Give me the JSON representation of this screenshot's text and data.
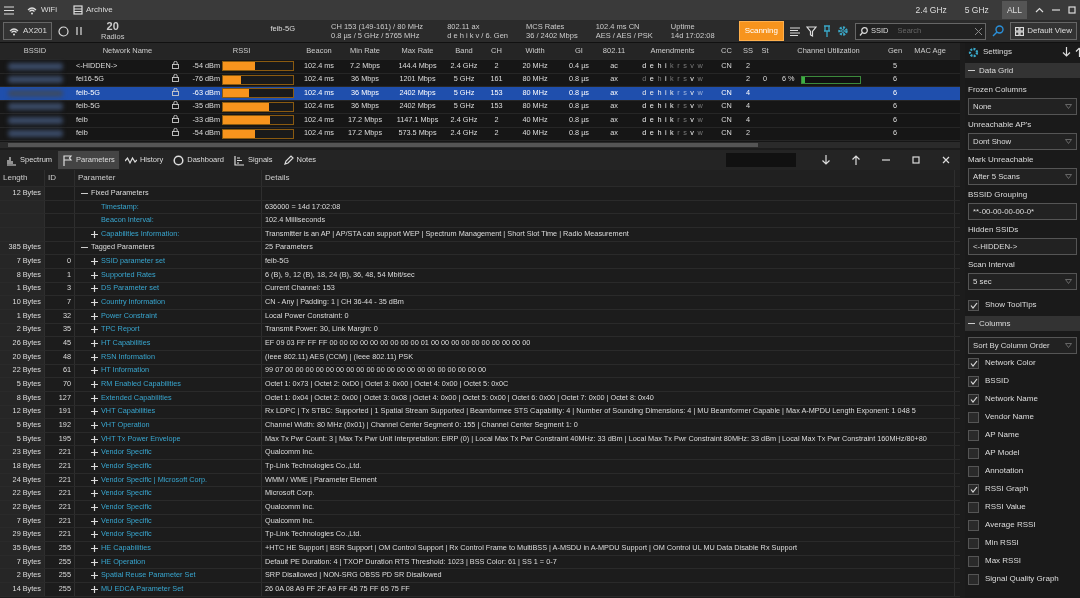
{
  "title_bar": {
    "menu_items": [
      "WiFi",
      "Archive"
    ],
    "band_filters": [
      {
        "label": "2.4 GHz",
        "selected": false
      },
      {
        "label": "5 GHz",
        "selected": false
      },
      {
        "label": "ALL",
        "selected": true
      }
    ]
  },
  "toolbar": {
    "adapter": "AX201",
    "radios_count": "20",
    "radios_label": "Radios",
    "ssid": "feib-5G",
    "info": [
      {
        "line1": "CH  153 (149-161)  /  80 MHz",
        "line2": "0.8 µs / 5 GHz / 5765 MHz"
      },
      {
        "line1": "802.11 ax",
        "line2": "d  e  h  i  k  v  /  6. Gen"
      },
      {
        "line1": "MCS Rates",
        "line2": "36 / 2402 Mbps"
      },
      {
        "line1": "102.4 ms   CN",
        "line2": "AES / AES / PSK"
      },
      {
        "line1": "Uptime",
        "line2": "14d 17:02:08"
      }
    ],
    "scan_button": {
      "label": "Scanning",
      "on": true
    },
    "search": {
      "field": "SSID",
      "placeholder": "Search"
    },
    "view_button": "Default View"
  },
  "networks": {
    "columns": [
      "BSSID",
      "Network Name",
      "RSSI",
      "Beacon",
      "Min Rate",
      "Max Rate",
      "Band",
      "CH",
      "Width",
      "GI",
      "802.11",
      "Amendments",
      "CC",
      "SS",
      "St",
      "Channel Utilization",
      "Gen",
      "MAC Age"
    ],
    "rows": [
      {
        "name": "<-HIDDEN->",
        "rssi": "-54 dBm",
        "level": 0.45,
        "beacon": "102.4 ms",
        "min_rate": "7.2 Mbps",
        "max_rate": "144.4 Mbps",
        "band": "2.4 GHz",
        "ch": "2",
        "width": "20 MHz",
        "gi": "0.4 µs",
        "std": "ac",
        "cc": "CN",
        "ss": "2",
        "gen": "5",
        "selected": false,
        "amendments": [
          {
            "letter": "d",
            "on": true
          },
          {
            "letter": "e",
            "on": true
          },
          {
            "letter": "h",
            "on": true
          },
          {
            "letter": "i",
            "on": true
          },
          {
            "letter": "k",
            "on": false
          },
          {
            "letter": "r",
            "on": false
          },
          {
            "letter": "s",
            "on": false
          },
          {
            "letter": "v",
            "on": false
          },
          {
            "letter": "w",
            "on": false
          }
        ]
      },
      {
        "name": "fei16-5G",
        "rssi": "-76 dBm",
        "level": 0.25,
        "beacon": "102.4 ms",
        "min_rate": "36 Mbps",
        "max_rate": "1201 Mbps",
        "band": "5 GHz",
        "ch": "161",
        "width": "80 MHz",
        "gi": "0.8 µs",
        "std": "ax",
        "ss": "2",
        "st": "0",
        "utilization": {
          "text": "6 %",
          "level": 0.06
        },
        "gen": "6",
        "selected": false,
        "amendments": [
          {
            "letter": "d",
            "on": false
          },
          {
            "letter": "e",
            "on": true
          },
          {
            "letter": "h",
            "on": false
          },
          {
            "letter": "i",
            "on": true
          },
          {
            "letter": "k",
            "on": false
          },
          {
            "letter": "r",
            "on": false
          },
          {
            "letter": "s",
            "on": false
          },
          {
            "letter": "v",
            "on": true
          },
          {
            "letter": "w",
            "on": false
          }
        ]
      },
      {
        "name": "feib-5G",
        "rssi": "-63 dBm",
        "level": 0.37,
        "beacon": "102.4 ms",
        "min_rate": "36 Mbps",
        "max_rate": "2402 Mbps",
        "band": "5 GHz",
        "ch": "153",
        "width": "80 MHz",
        "gi": "0.8 µs",
        "std": "ax",
        "cc": "CN",
        "ss": "4",
        "gen": "6",
        "selected": true,
        "amendments": [
          {
            "letter": "d",
            "on": true
          },
          {
            "letter": "e",
            "on": true
          },
          {
            "letter": "h",
            "on": true
          },
          {
            "letter": "i",
            "on": true
          },
          {
            "letter": "k",
            "on": true
          },
          {
            "letter": "r",
            "on": false
          },
          {
            "letter": "s",
            "on": false
          },
          {
            "letter": "v",
            "on": true
          },
          {
            "letter": "w",
            "on": false
          }
        ]
      },
      {
        "name": "feib-5G",
        "rssi": "-35 dBm",
        "level": 0.65,
        "beacon": "102.4 ms",
        "min_rate": "36 Mbps",
        "max_rate": "2402 Mbps",
        "band": "5 GHz",
        "ch": "153",
        "width": "80 MHz",
        "gi": "0.8 µs",
        "std": "ax",
        "cc": "CN",
        "ss": "4",
        "gen": "6",
        "selected": false,
        "amendments": [
          {
            "letter": "d",
            "on": true
          },
          {
            "letter": "e",
            "on": true
          },
          {
            "letter": "h",
            "on": true
          },
          {
            "letter": "i",
            "on": true
          },
          {
            "letter": "k",
            "on": true
          },
          {
            "letter": "r",
            "on": false
          },
          {
            "letter": "s",
            "on": false
          },
          {
            "letter": "v",
            "on": true
          },
          {
            "letter": "w",
            "on": false
          }
        ]
      },
      {
        "name": "feib",
        "rssi": "-33 dBm",
        "level": 0.67,
        "beacon": "102.4 ms",
        "min_rate": "17.2 Mbps",
        "max_rate": "1147.1 Mbps",
        "band": "2.4 GHz",
        "ch": "2",
        "width": "40 MHz",
        "gi": "0.8 µs",
        "std": "ax",
        "cc": "CN",
        "ss": "4",
        "gen": "6",
        "selected": false,
        "amendments": [
          {
            "letter": "d",
            "on": true
          },
          {
            "letter": "e",
            "on": true
          },
          {
            "letter": "h",
            "on": true
          },
          {
            "letter": "i",
            "on": true
          },
          {
            "letter": "k",
            "on": true
          },
          {
            "letter": "r",
            "on": false
          },
          {
            "letter": "s",
            "on": false
          },
          {
            "letter": "v",
            "on": true
          },
          {
            "letter": "w",
            "on": false
          }
        ]
      },
      {
        "name": "feib",
        "rssi": "-54 dBm",
        "level": 0.45,
        "beacon": "102.4 ms",
        "min_rate": "17.2 Mbps",
        "max_rate": "573.5 Mbps",
        "band": "2.4 GHz",
        "ch": "2",
        "width": "40 MHz",
        "gi": "0.8 µs",
        "std": "ax",
        "cc": "CN",
        "ss": "2",
        "gen": "6",
        "selected": false,
        "amendments": [
          {
            "letter": "d",
            "on": true
          },
          {
            "letter": "e",
            "on": true
          },
          {
            "letter": "h",
            "on": true
          },
          {
            "letter": "i",
            "on": true
          },
          {
            "letter": "k",
            "on": true
          },
          {
            "letter": "r",
            "on": false
          },
          {
            "letter": "s",
            "on": false
          },
          {
            "letter": "v",
            "on": true
          },
          {
            "letter": "w",
            "on": false
          }
        ]
      }
    ]
  },
  "detail_tabs": [
    {
      "label": "Spectrum",
      "selected": false
    },
    {
      "label": "Parameters",
      "selected": true
    },
    {
      "label": "History",
      "selected": false
    },
    {
      "label": "Dashboard",
      "selected": false
    },
    {
      "label": "Signals",
      "selected": false
    },
    {
      "label": "Notes",
      "selected": false
    }
  ],
  "parameters": {
    "columns": [
      "Length",
      "ID",
      "Parameter",
      "Details"
    ],
    "rows": [
      {
        "length": "12 Bytes",
        "name": "Fixed Parameters",
        "kind": "group",
        "expanded": true,
        "children": [
          {
            "name": "Timestamp:",
            "details": "636000 = 14d 17:02:08",
            "kind": "leaf"
          },
          {
            "name": "Beacon Interval:",
            "details": "102.4 Milliseconds",
            "kind": "leaf"
          },
          {
            "name": "Capabilities Information:",
            "details": "Transmitter is an AP   |   AP/STA can support WEP   |   Spectrum Management   |   Short Slot Time   |   Radio Measurement",
            "kind": "node",
            "expanded": false
          }
        ]
      },
      {
        "length": "385 Bytes",
        "name": "Tagged Parameters",
        "details": "25 Parameters",
        "kind": "group",
        "expanded": true,
        "children": [
          {
            "length": "7 Bytes",
            "id": "0",
            "name": "SSID parameter set",
            "details": "feib-5G",
            "kind": "node",
            "expanded": false
          },
          {
            "length": "8 Bytes",
            "id": "1",
            "name": "Supported Rates",
            "details": "6 (B), 9, 12 (B), 18, 24 (B), 36, 48, 54  Mbit/sec",
            "kind": "node",
            "expanded": false
          },
          {
            "length": "1 Bytes",
            "id": "3",
            "name": "DS Parameter set",
            "details": "Current Channel: 153",
            "kind": "node",
            "expanded": false
          },
          {
            "length": "10 Bytes",
            "id": "7",
            "name": "Country Information",
            "details": "CN  -  Any   |   Padding: 1   |   CH 36-44  -  35 dBm",
            "kind": "node",
            "expanded": false
          },
          {
            "length": "1 Bytes",
            "id": "32",
            "name": "Power Constraint",
            "details": "Local Power Constraint: 0",
            "kind": "node",
            "expanded": false
          },
          {
            "length": "2 Bytes",
            "id": "35",
            "name": "TPC Report",
            "details": "Transmit Power: 30, Link Margin: 0",
            "kind": "node",
            "expanded": false
          },
          {
            "length": "26 Bytes",
            "id": "45",
            "name": "HT Capabilities",
            "details": "EF 09 03 FF FF FF 00 00 00 00 00 00 00 00 00 01 00 00 00 00 00 00 00 00 00 00",
            "kind": "node",
            "expanded": false
          },
          {
            "length": "20 Bytes",
            "id": "48",
            "name": "RSN Information",
            "details": "(Ieee 802.11) AES (CCM)  |  (Ieee 802.11) PSK",
            "kind": "node",
            "expanded": false
          },
          {
            "length": "22 Bytes",
            "id": "61",
            "name": "HT Information",
            "details": "99 07 00 00 00 00 00 00 00 00 00 00 00 00 00 00 00 00 00 00 00 00",
            "kind": "node",
            "expanded": false
          },
          {
            "length": "5 Bytes",
            "id": "70",
            "name": "RM Enabled Capabilities",
            "details": "Octet 1:  0x73   |   Octet 2:  0xD0   |   Octet 3:  0x00   |   Octet 4:  0x00   |   Octet 5:  0x0C",
            "kind": "node",
            "expanded": false
          },
          {
            "length": "8 Bytes",
            "id": "127",
            "name": "Extended Capabilities",
            "details": "Octet 1:  0x04   |   Octet 2:  0x00   |   Octet 3:  0x08   |   Octet 4:  0x00   |   Octet 5:  0x00   |   Octet 6:  0x00   |   Octet 7:  0x00   |   Octet 8:  0x40",
            "kind": "node",
            "expanded": false
          },
          {
            "length": "12 Bytes",
            "id": "191",
            "name": "VHT Capabilities",
            "details": "Rx LDPC   |   Tx STBC: Supported   |   1 Spatial Stream Supported   |   Beamformee STS Capability: 4   |   Number of Sounding Dimensions: 4   |   MU Beamformer Capable   |   Max A-MPDU Length Exponent: 1 048 5",
            "kind": "node",
            "expanded": false
          },
          {
            "length": "5 Bytes",
            "id": "192",
            "name": "VHT Operation",
            "details": "Channel Width: 80 MHz (0x01)   |   Channel Center Segment 0: 155   |   Channel Center Segment 1: 0",
            "kind": "node",
            "expanded": false
          },
          {
            "length": "5 Bytes",
            "id": "195",
            "name": "VHT Tx Power Envelope",
            "details": "Max Tx Pwr Count: 3   |   Max Tx Pwr Unit Interpretation: EIRP (0)   |   Local Max Tx Pwr Constraint 40MHz: 33 dBm   |   Local Max Tx Pwr Constraint 80MHz: 33 dBm   |   Local Max Tx Pwr Constraint 160MHz/80+80",
            "kind": "node",
            "expanded": false
          },
          {
            "length": "23 Bytes",
            "id": "221",
            "name": "Vendor Specific",
            "details": "Qualcomm Inc.",
            "kind": "node",
            "expanded": false
          },
          {
            "length": "18 Bytes",
            "id": "221",
            "name": "Vendor Specific",
            "details": "Tp-Link Technologies Co.,Ltd.",
            "kind": "node",
            "expanded": false
          },
          {
            "length": "24 Bytes",
            "id": "221",
            "name": "Vendor Specific   |   Microsoft Corp.",
            "details": "WMM / WME   |   Parameter Element",
            "kind": "node",
            "expanded": false
          },
          {
            "length": "22 Bytes",
            "id": "221",
            "name": "Vendor Specific",
            "details": "Microsoft Corp.",
            "kind": "node",
            "expanded": false
          },
          {
            "length": "22 Bytes",
            "id": "221",
            "name": "Vendor Specific",
            "details": "Qualcomm Inc.",
            "kind": "node",
            "expanded": false
          },
          {
            "length": "7 Bytes",
            "id": "221",
            "name": "Vendor Specific",
            "details": "Qualcomm Inc.",
            "kind": "node",
            "expanded": false
          },
          {
            "length": "29 Bytes",
            "id": "221",
            "name": "Vendor Specific",
            "details": "Tp-Link Technologies Co.,Ltd.",
            "kind": "node",
            "expanded": false
          },
          {
            "length": "35 Bytes",
            "id": "255",
            "name": "HE Capabilities",
            "details": "+HTC HE Support   |   BSR Support   |   OM Control Support   |   Rx Control Frame to MultiBSS   |   A-MSDU in A-MPDU Support   |   OM Control UL MU Data Disable Rx Support",
            "kind": "node",
            "expanded": false
          },
          {
            "length": "7 Bytes",
            "id": "255",
            "name": "HE Operation",
            "details": "Default PE Duration: 4   |   TXOP Duration RTS Threshold: 1023   |   BSS Color: 61   |   SS 1 = 0-7",
            "kind": "node",
            "expanded": false
          },
          {
            "length": "2 Bytes",
            "id": "255",
            "name": "Spatial Reuse Parameter Set",
            "details": "SRP Disallowed   |   NON-SRG OBSS PD SR Disallowed",
            "kind": "node",
            "expanded": false
          },
          {
            "length": "14 Bytes",
            "id": "255",
            "name": "MU EDCA Parameter Set",
            "details": "26 0A 08 A9 FF 2F A9 FF 45 75 FF 65 75 FF",
            "kind": "node",
            "expanded": false
          }
        ]
      }
    ]
  },
  "settings": {
    "title": "Settings",
    "sections": [
      {
        "title": "Data Grid",
        "expanded": true,
        "items": [
          {
            "kind": "select",
            "label": "Frozen Columns",
            "value": "None"
          },
          {
            "kind": "select",
            "label": "Unreachable AP's",
            "value": "Dont Show"
          },
          {
            "kind": "select",
            "label": "Mark Unreachable",
            "value": "After 5 Scans"
          },
          {
            "kind": "input",
            "label": "BSSID Grouping",
            "value": "**-00-00-00-00-0*"
          },
          {
            "kind": "input",
            "label": "Hidden SSIDs",
            "value": "<-HIDDEN->"
          },
          {
            "kind": "select",
            "label": "Scan Interval",
            "value": "5 sec"
          },
          {
            "kind": "check",
            "label": "Show ToolTips",
            "checked": true
          }
        ]
      },
      {
        "title": "Columns",
        "expanded": true,
        "items": [
          {
            "kind": "select",
            "value": "Sort By Column Order"
          },
          {
            "kind": "check",
            "label": "Network Color",
            "checked": true
          },
          {
            "kind": "check",
            "label": "BSSID",
            "checked": true
          },
          {
            "kind": "check",
            "label": "Network Name",
            "checked": true
          },
          {
            "kind": "check",
            "label": "Vendor Name",
            "checked": false
          },
          {
            "kind": "check",
            "label": "AP Name",
            "checked": false
          },
          {
            "kind": "check",
            "label": "AP Model",
            "checked": false
          },
          {
            "kind": "check",
            "label": "Annotation",
            "checked": false
          },
          {
            "kind": "check",
            "label": "RSSI Graph",
            "checked": true
          },
          {
            "kind": "check",
            "label": "RSSI Value",
            "checked": false
          },
          {
            "kind": "check",
            "label": "Average RSSI",
            "checked": false
          },
          {
            "kind": "check",
            "label": "Min RSSI",
            "checked": false
          },
          {
            "kind": "check",
            "label": "Max RSSI",
            "checked": false
          },
          {
            "kind": "check",
            "label": "Signal Quality Graph",
            "checked": false
          }
        ]
      }
    ]
  }
}
